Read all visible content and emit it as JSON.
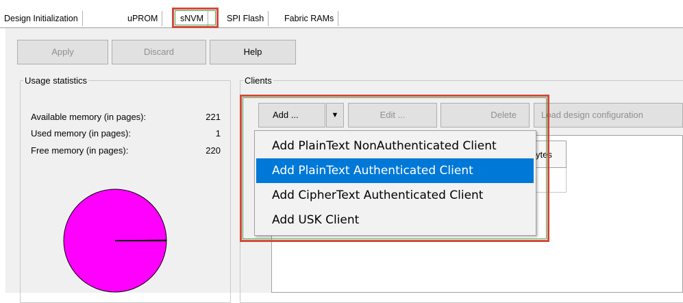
{
  "tabs": [
    {
      "label": "Design Initialization"
    },
    {
      "label": "uPROM"
    },
    {
      "label": "sNVM"
    },
    {
      "label": "SPI Flash"
    },
    {
      "label": "Fabric RAMs"
    }
  ],
  "toolbar": {
    "apply": "Apply",
    "discard": "Discard",
    "help": "Help"
  },
  "usage": {
    "title": "Usage statistics",
    "available_label": "Available memory (in pages):",
    "available_value": "221",
    "used_label": "Used memory (in pages):",
    "used_value": "1",
    "free_label": "Free memory (in pages):",
    "free_value": "220",
    "pie_color": "#ff00ff"
  },
  "clients": {
    "title": "Clients",
    "add": "Add ...",
    "edit": "Edit ...",
    "delete": "Delete",
    "load": "Load design configuration",
    "column_partial": "ytes"
  },
  "add_menu": {
    "items": [
      {
        "label": "Add PlainText NonAuthenticated Client"
      },
      {
        "label": "Add PlainText Authenticated Client"
      },
      {
        "label": "Add CipherText Authenticated Client"
      },
      {
        "label": "Add USK Client"
      }
    ],
    "selected_index": 1
  },
  "colors": {
    "highlight_red": "#d14a3c",
    "highlight_green": "#4a9a4a",
    "selection_blue": "#0078d7"
  }
}
